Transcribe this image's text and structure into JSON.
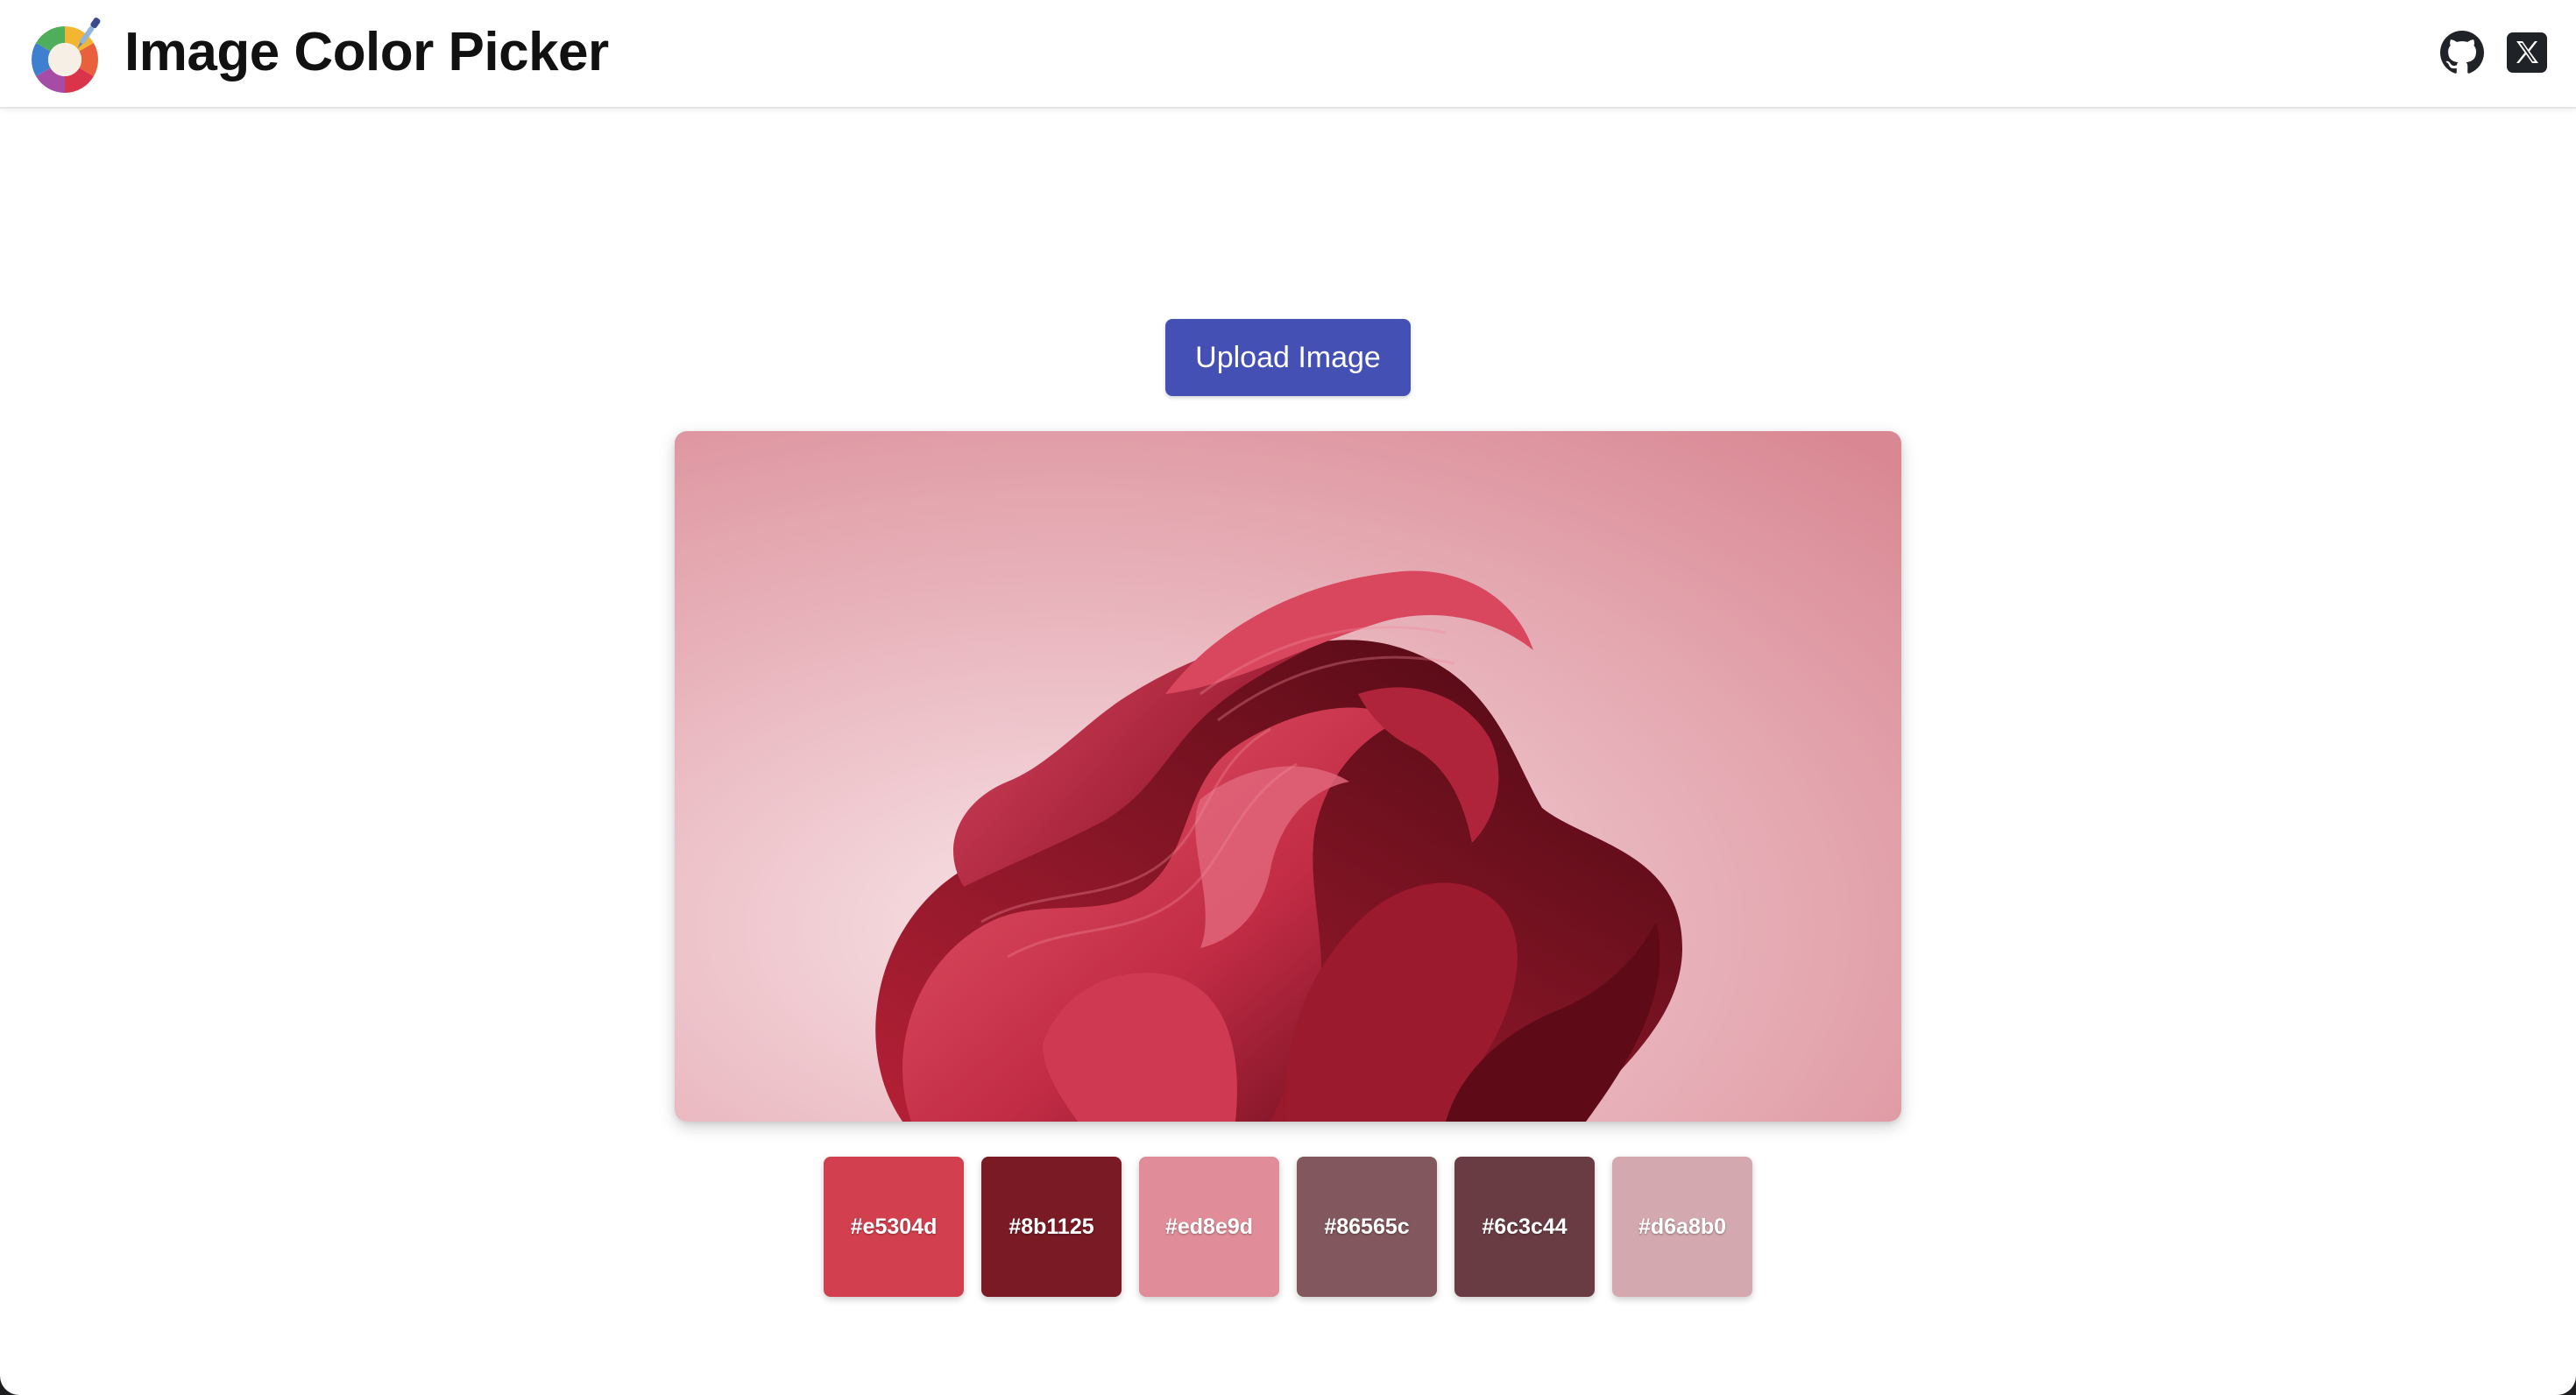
{
  "header": {
    "title": "Image Color Picker",
    "github_icon": "github-icon",
    "x_icon": "x-twitter-icon"
  },
  "upload": {
    "label": "Upload Image",
    "color": "#4550b5"
  },
  "palette": [
    {
      "hex": "#e5304d",
      "color": "#d2404f"
    },
    {
      "hex": "#8b1125",
      "color": "#7a1a25"
    },
    {
      "hex": "#ed8e9d",
      "color": "#e08d99"
    },
    {
      "hex": "#86565c",
      "color": "#82585e"
    },
    {
      "hex": "#6c3c44",
      "color": "#693c43"
    },
    {
      "hex": "#d6a8b0",
      "color": "#d3a8ae"
    }
  ]
}
